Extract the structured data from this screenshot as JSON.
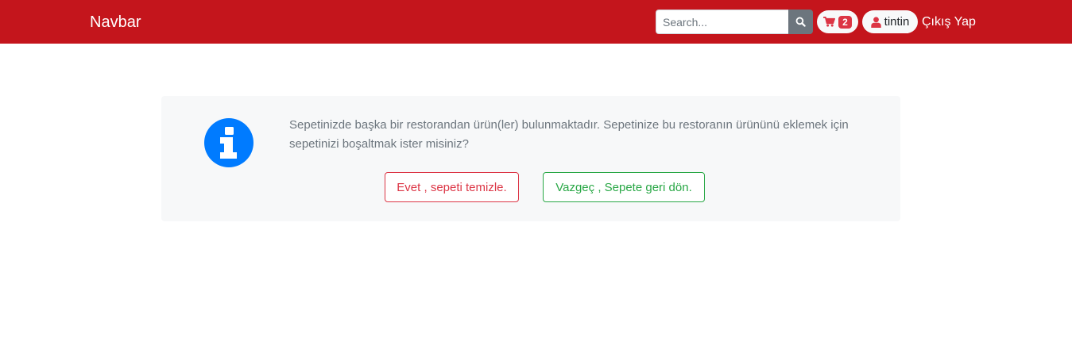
{
  "navbar": {
    "brand": "Navbar",
    "background_color": "#c4151c",
    "search": {
      "placeholder": "Search...",
      "value": "",
      "button_icon": "search-icon"
    },
    "cart": {
      "icon": "shopping-cart-icon",
      "count": "2"
    },
    "user": {
      "icon": "user-icon",
      "name": "tintin"
    },
    "logout_label": "Çıkış Yap"
  },
  "alert": {
    "icon": "info-circle-icon",
    "icon_color": "#007bff",
    "message": "Sepetinizde başka bir restorandan ürün(ler) bulunmaktadır. Sepetinize bu restoranın ürününü eklemek için sepetinizi boşaltmak ister misiniz?",
    "confirm_label": "Evet , sepeti temizle.",
    "cancel_label": "Vazgeç , Sepete geri dön.",
    "confirm_color": "#dc3545",
    "cancel_color": "#28a745"
  }
}
